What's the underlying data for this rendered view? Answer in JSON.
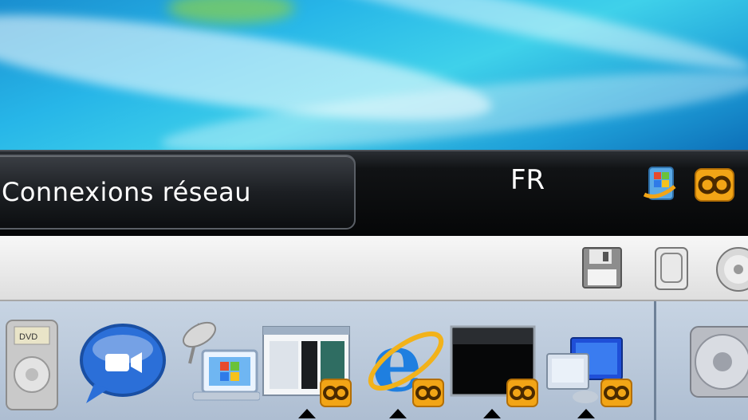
{
  "desktop": {
    "wallpaper": "windows-7-aurora"
  },
  "taskbar": {
    "active_task_label": "Connexions réseau",
    "language": "FR",
    "tray_icons": [
      "windows-messenger-icon",
      "remote-link-icon"
    ]
  },
  "status_bar": {
    "icons": [
      "floppy-disk-icon",
      "removable-drive-icon",
      "cd-drive-icon"
    ]
  },
  "dock": {
    "apps": [
      "dvd-player-icon",
      "ichat-icon",
      "network-connection-icon",
      "window-app-icon",
      "internet-explorer-icon",
      "black-window-icon",
      "remote-desktop-icon",
      "dvd-disc-icon"
    ],
    "linked_badge": "remote-link-badge-icon"
  },
  "colors": {
    "taskbar": "#0b0d0f",
    "accent_orange": "#f2a516",
    "dock": "#b9c7d8"
  }
}
